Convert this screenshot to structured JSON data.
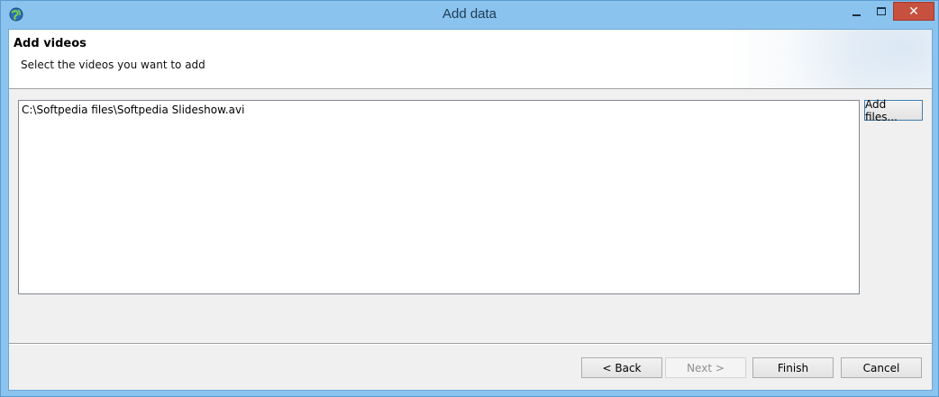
{
  "window": {
    "title": "Add data",
    "app_icon": "globe-app-icon",
    "controls": {
      "minimize": "minimize-icon",
      "maximize": "maximize-icon",
      "close": "close-icon",
      "close_glyph": "✕"
    }
  },
  "header": {
    "title": "Add videos",
    "subtitle": "Select the videos you want to add"
  },
  "file_list": {
    "items": [
      "C:\\Softpedia files\\Softpedia Slideshow.avi"
    ]
  },
  "buttons": {
    "add_files": "Add files...",
    "back": "< Back",
    "next": "Next >",
    "finish": "Finish",
    "cancel": "Cancel"
  },
  "colors": {
    "title_bar": "#8ac3ee",
    "close_button": "#c7503f",
    "dialog_background": "#f0f0f0"
  }
}
